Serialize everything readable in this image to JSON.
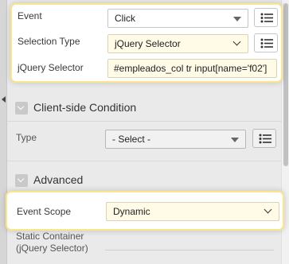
{
  "event_row": {
    "label": "Event",
    "value": "Click"
  },
  "selection_type_row": {
    "label": "Selection Type",
    "value": "jQuery Selector"
  },
  "jquery_selector_row": {
    "label": "jQuery Selector",
    "value": "#empleados_col tr input[name='f02']"
  },
  "client_side_condition": {
    "title": "Client-side Condition",
    "type_label": "Type",
    "type_value": "- Select -"
  },
  "advanced": {
    "title": "Advanced",
    "event_scope_label": "Event Scope",
    "event_scope_value": "Dynamic",
    "static_container_label_line1": "Static Container",
    "static_container_label_line2": "(jQuery Selector)"
  },
  "icons": {
    "list_button": "list-icon",
    "section_toggle": "chevron-down-icon",
    "panel_collapse": "caret-left-icon"
  },
  "colors": {
    "highlight_border": "#fbe48a",
    "required_field_bg": "#fffbe6",
    "panel_bg": "#eaeaea"
  }
}
